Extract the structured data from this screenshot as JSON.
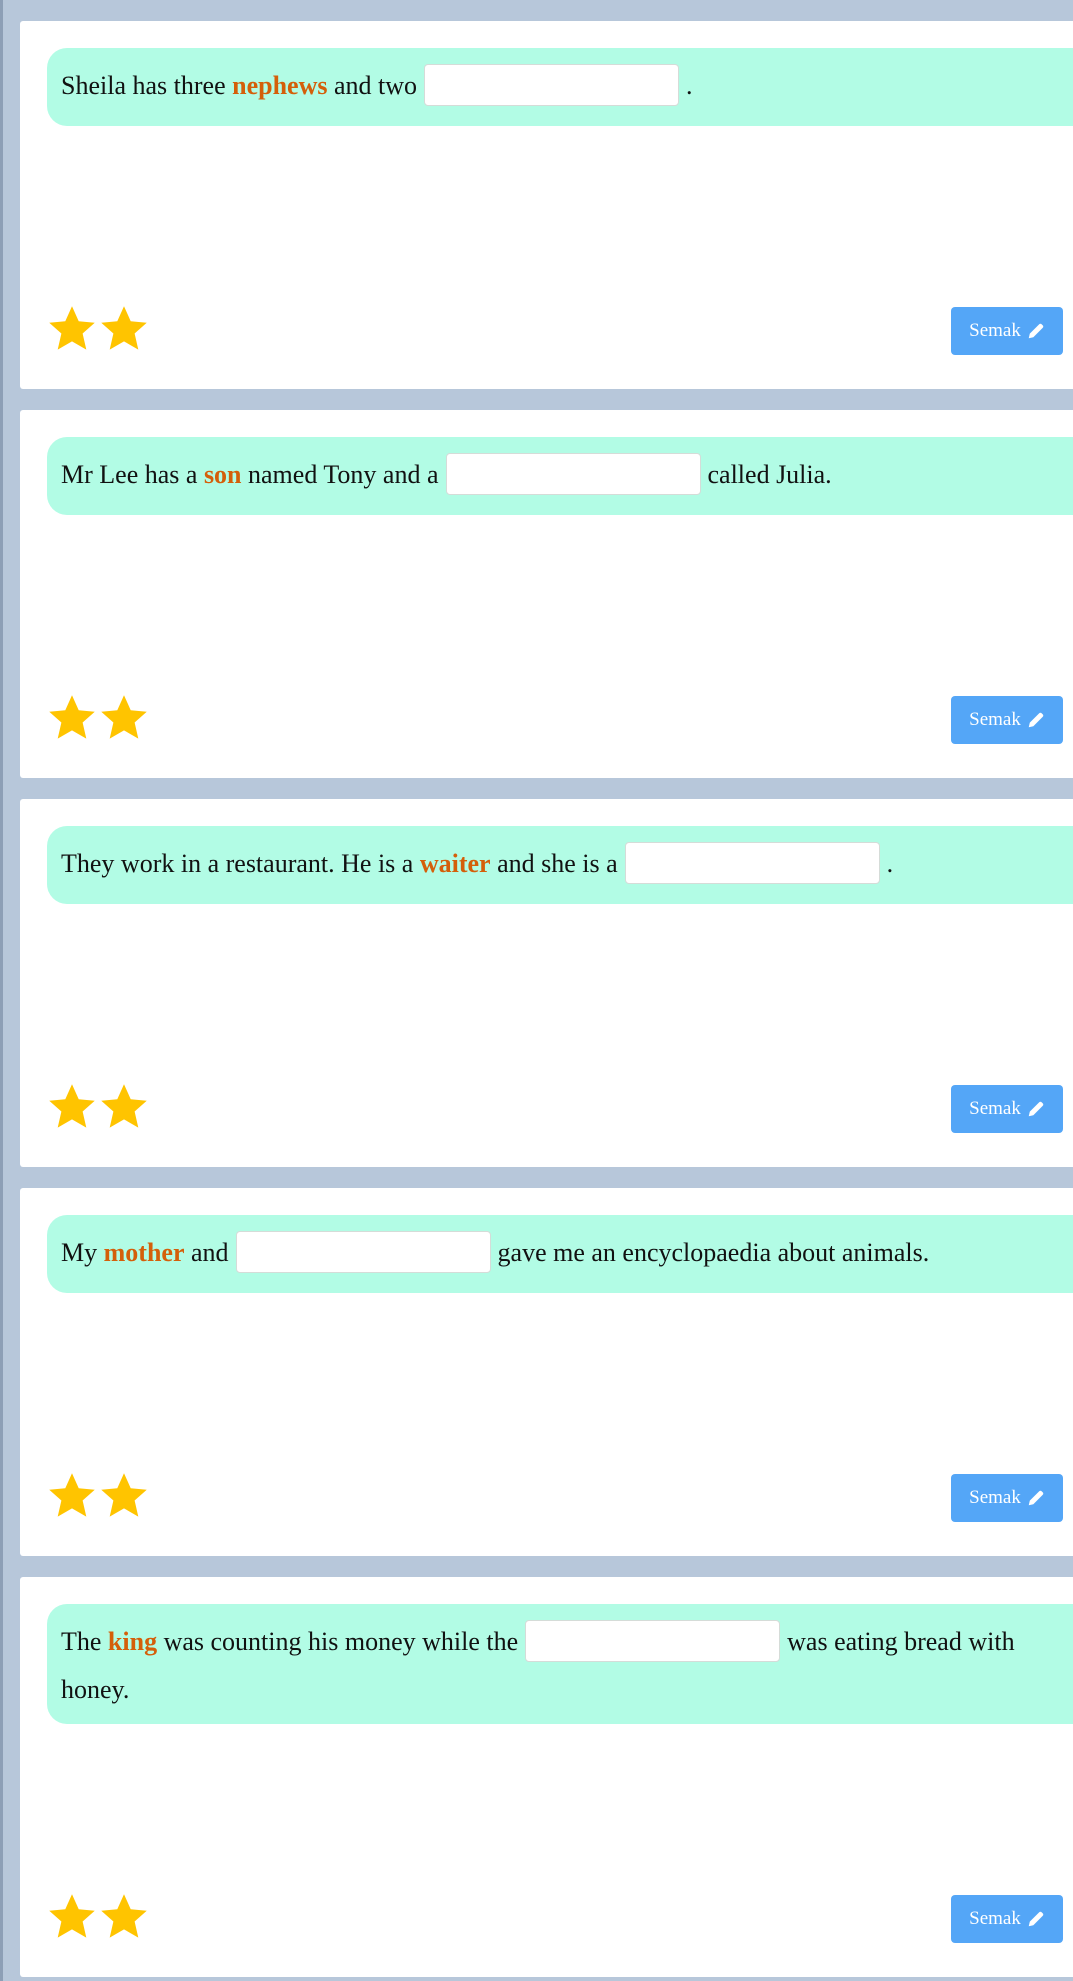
{
  "colors": {
    "background": "#b7c7da",
    "card": "#ffffff",
    "prompt_bg": "#b2fce5",
    "highlight": "#d45f0a",
    "button": "#54a6f7",
    "star": "#ffc400"
  },
  "questions": [
    {
      "before": "Sheila has three ",
      "highlight": "nephews",
      "middle": " and two",
      "blank_value": "",
      "after": ".",
      "stars": 2,
      "button_label": "Semak",
      "button_icon": "pencil-icon"
    },
    {
      "before": "Mr Lee has a ",
      "highlight": "son",
      "middle": " named Tony and a",
      "blank_value": "",
      "after": "called Julia.",
      "stars": 2,
      "button_label": "Semak",
      "button_icon": "pencil-icon"
    },
    {
      "before": "They work in a restaurant. He is a ",
      "highlight": "waiter",
      "middle": " and she is a",
      "blank_value": "",
      "after": ".",
      "stars": 2,
      "button_label": "Semak",
      "button_icon": "pencil-icon"
    },
    {
      "before": "My ",
      "highlight": "mother",
      "middle": " and",
      "blank_value": "",
      "after": "gave me an encyclopaedia about animals.",
      "stars": 2,
      "button_label": "Semak",
      "button_icon": "pencil-icon"
    },
    {
      "before": "The ",
      "highlight": "king",
      "middle": " was counting his money while the",
      "blank_value": "",
      "after": "was eating bread with honey.",
      "stars": 2,
      "button_label": "Semak",
      "button_icon": "pencil-icon"
    }
  ]
}
